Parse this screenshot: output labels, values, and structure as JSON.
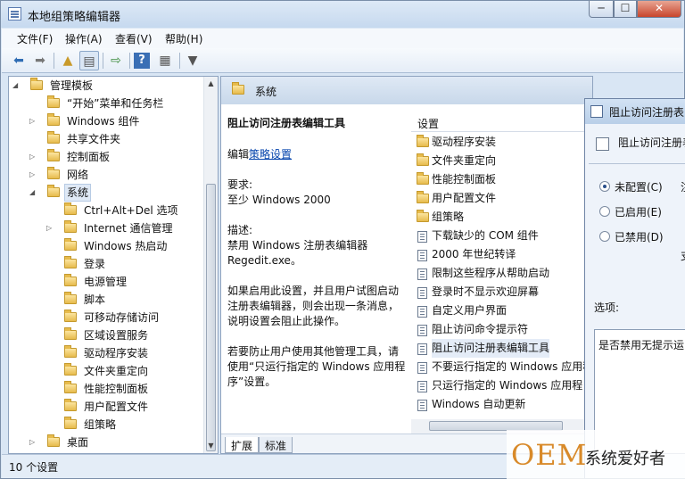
{
  "window": {
    "title": "本地组策略编辑器",
    "controls": {
      "minimize": "─",
      "maximize": "☐",
      "close": "✕"
    }
  },
  "menu": [
    "文件(F)",
    "操作(A)",
    "查看(V)",
    "帮助(H)"
  ],
  "tree": [
    {
      "label": "管理模板",
      "level": 0,
      "expander": "open"
    },
    {
      "label": "“开始”菜单和任务栏",
      "level": 1,
      "expander": ""
    },
    {
      "label": "Windows 组件",
      "level": 1,
      "expander": "closed"
    },
    {
      "label": "共享文件夹",
      "level": 1,
      "expander": ""
    },
    {
      "label": "控制面板",
      "level": 1,
      "expander": "closed"
    },
    {
      "label": "网络",
      "level": 1,
      "expander": "closed"
    },
    {
      "label": "系统",
      "level": 1,
      "expander": "open",
      "selected": true
    },
    {
      "label": "Ctrl+Alt+Del 选项",
      "level": 2,
      "expander": ""
    },
    {
      "label": "Internet 通信管理",
      "level": 2,
      "expander": "closed"
    },
    {
      "label": "Windows 热启动",
      "level": 2,
      "expander": ""
    },
    {
      "label": "登录",
      "level": 2,
      "expander": ""
    },
    {
      "label": "电源管理",
      "level": 2,
      "expander": ""
    },
    {
      "label": "脚本",
      "level": 2,
      "expander": ""
    },
    {
      "label": "可移动存储访问",
      "level": 2,
      "expander": ""
    },
    {
      "label": "区域设置服务",
      "level": 2,
      "expander": ""
    },
    {
      "label": "驱动程序安装",
      "level": 2,
      "expander": ""
    },
    {
      "label": "文件夹重定向",
      "level": 2,
      "expander": ""
    },
    {
      "label": "性能控制面板",
      "level": 2,
      "expander": ""
    },
    {
      "label": "用户配置文件",
      "level": 2,
      "expander": ""
    },
    {
      "label": "组策略",
      "level": 2,
      "expander": ""
    },
    {
      "label": "桌面",
      "level": 1,
      "expander": "closed"
    }
  ],
  "right": {
    "header": "系统",
    "desc": {
      "title": "阻止访问注册表编辑工具",
      "edit_prefix": "编辑",
      "edit_link": "策略设置",
      "req_label": "要求:",
      "req_value": "至少 Windows 2000",
      "desc_label": "描述:",
      "desc_text": "禁用 Windows 注册表编辑器 Regedit.exe。",
      "para1": "如果启用此设置，并且用户试图启动注册表编辑器，则会出现一条消息，说明设置会阻止此操作。",
      "para2": "若要防止用户使用其他管理工具，请使用“只运行指定的 Windows 应用程序”设置。"
    },
    "settings_header": "设置",
    "settings": [
      {
        "label": "驱动程序安装",
        "kind": "folder"
      },
      {
        "label": "文件夹重定向",
        "kind": "folder"
      },
      {
        "label": "性能控制面板",
        "kind": "folder"
      },
      {
        "label": "用户配置文件",
        "kind": "folder"
      },
      {
        "label": "组策略",
        "kind": "folder"
      },
      {
        "label": "下载缺少的 COM 组件",
        "kind": "policy"
      },
      {
        "label": "2000 年世纪转译",
        "kind": "policy"
      },
      {
        "label": "限制这些程序从帮助启动",
        "kind": "policy"
      },
      {
        "label": "登录时不显示欢迎屏幕",
        "kind": "policy"
      },
      {
        "label": "自定义用户界面",
        "kind": "policy"
      },
      {
        "label": "阻止访问命令提示符",
        "kind": "policy"
      },
      {
        "label": "阻止访问注册表编辑工具",
        "kind": "policy",
        "selected": true
      },
      {
        "label": "不要运行指定的 Windows 应用程",
        "kind": "policy"
      },
      {
        "label": "只运行指定的 Windows 应用程",
        "kind": "policy"
      },
      {
        "label": "Windows 自动更新",
        "kind": "policy"
      }
    ],
    "tabs": [
      "扩展",
      "标准"
    ]
  },
  "status": "10 个设置",
  "dialog": {
    "title": "阻止访问注册表",
    "heading": "阻止访问注册表",
    "radios": [
      {
        "label": "未配置(C)",
        "checked": true
      },
      {
        "label": "已启用(E)",
        "checked": false
      },
      {
        "label": "已禁用(D)",
        "checked": false
      }
    ],
    "side1": "注",
    "side2": "支",
    "options_label": "选项:",
    "options_text": "是否禁用无提示运"
  },
  "watermark": {
    "oem": "OEM",
    "cn": "系统爱好者"
  }
}
